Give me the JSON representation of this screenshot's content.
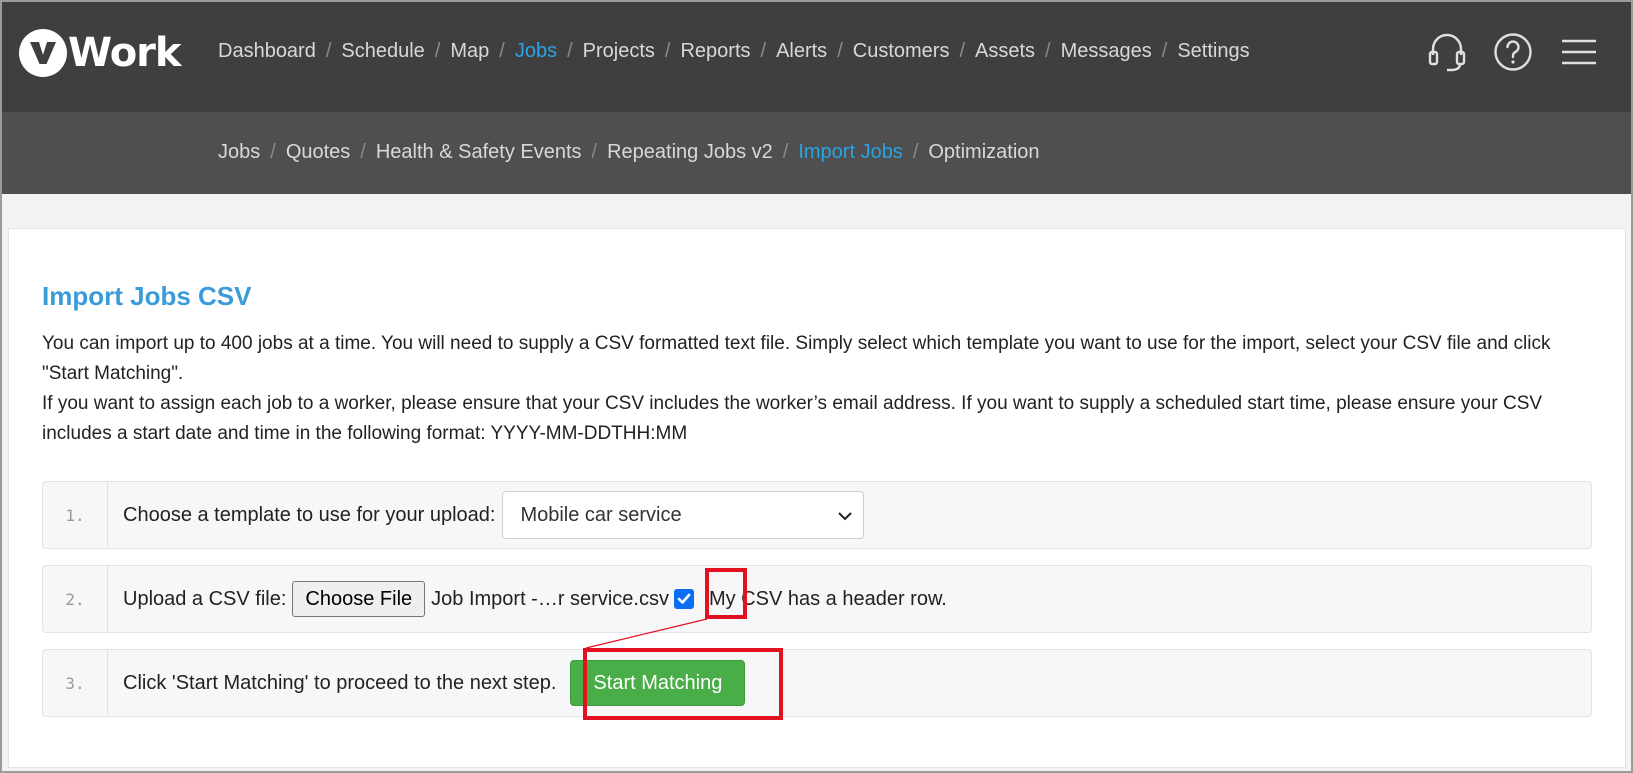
{
  "app": {
    "logo_text": "Work"
  },
  "main_nav": {
    "items": [
      {
        "label": "Dashboard",
        "active": false
      },
      {
        "label": "Schedule",
        "active": false
      },
      {
        "label": "Map",
        "active": false
      },
      {
        "label": "Jobs",
        "active": true
      },
      {
        "label": "Projects",
        "active": false
      },
      {
        "label": "Reports",
        "active": false
      },
      {
        "label": "Alerts",
        "active": false
      },
      {
        "label": "Customers",
        "active": false
      },
      {
        "label": "Assets",
        "active": false
      },
      {
        "label": "Messages",
        "active": false
      },
      {
        "label": "Settings",
        "active": false
      }
    ],
    "separator": "/"
  },
  "tool_icons": [
    "headset-icon",
    "help-icon",
    "menu-icon"
  ],
  "sub_nav": {
    "items": [
      {
        "label": "Jobs",
        "active": false
      },
      {
        "label": "Quotes",
        "active": false
      },
      {
        "label": "Health & Safety Events",
        "active": false
      },
      {
        "label": "Repeating Jobs v2",
        "active": false
      },
      {
        "label": "Import Jobs",
        "active": true
      },
      {
        "label": "Optimization",
        "active": false
      }
    ],
    "separator": "/"
  },
  "page": {
    "title": "Import Jobs CSV",
    "description_line1": "You can import up to 400 jobs at a time. You will need to supply a CSV formatted text file. Simply select which template you want to use for the import, select your CSV file and click \"Start Matching\".",
    "description_line2": "If you want to assign each job to a worker, please ensure that your CSV includes the worker’s email address. If you want to supply a scheduled start time, please ensure your CSV includes a start date and time in the following format: YYYY-MM-DDTHH:MM"
  },
  "steps": {
    "step1": {
      "number": "1.",
      "label": "Choose a template to use for your upload:",
      "selected_template": "Mobile car service"
    },
    "step2": {
      "number": "2.",
      "label": "Upload a CSV file:",
      "file_button": "Choose File",
      "file_name": "Job Import -…r service.csv",
      "header_row_checked": true,
      "header_row_label": "My CSV has a header row."
    },
    "step3": {
      "number": "3.",
      "label": "Click 'Start Matching' to proceed to the next step.",
      "button_label": "Start Matching"
    }
  },
  "colors": {
    "topbar": "#3f3f3f",
    "subbar": "#4f4f4f",
    "active_link": "#2aa3e6",
    "title": "#3a9bd8",
    "primary_button": "#4aae48",
    "highlight": "#e3101f",
    "checkbox": "#0a6ef2"
  }
}
